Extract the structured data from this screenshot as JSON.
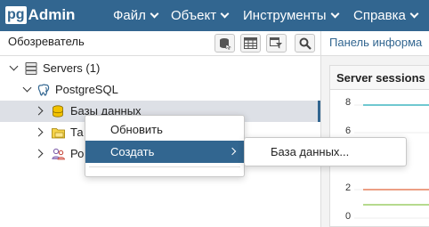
{
  "app": {
    "logo_pg": "pg",
    "logo_admin": "Admin"
  },
  "menu": [
    {
      "label": "Файл"
    },
    {
      "label": "Объект"
    },
    {
      "label": "Инструменты"
    },
    {
      "label": "Справка"
    }
  ],
  "browser": {
    "title": "Обозреватель",
    "toolbar": [
      {
        "icon": "database-query-icon"
      },
      {
        "icon": "table-view-icon"
      },
      {
        "icon": "filtered-rows-icon"
      },
      {
        "icon": "search-icon"
      }
    ]
  },
  "tree": [
    {
      "label": "Servers (1)",
      "icon": "servers-icon",
      "expanded": true
    },
    {
      "label": "PostgreSQL",
      "icon": "elephant-icon",
      "expanded": true
    },
    {
      "label": "Базы данных",
      "icon": "database-icon",
      "expanded": false,
      "selected": true
    },
    {
      "label": "Та",
      "icon": "folder-icon",
      "expanded": false
    },
    {
      "label": "Ро",
      "icon": "users-icon",
      "expanded": false
    }
  ],
  "dashboard": {
    "tab_label": "Панель информа",
    "card_title": "Server sessions",
    "y_ticks": [
      "8",
      "6",
      "2",
      "0"
    ],
    "colors": {
      "line1": "#1aa7b3",
      "line2": "#e0663b",
      "line3": "#8bc34a"
    }
  },
  "context_menu": {
    "items": [
      {
        "label": "Обновить"
      },
      {
        "label": "Создать",
        "has_submenu": true
      }
    ],
    "submenu": [
      {
        "label": "База данных..."
      }
    ]
  },
  "colors": {
    "brand": "#326690",
    "selection": "#dde0e6"
  }
}
